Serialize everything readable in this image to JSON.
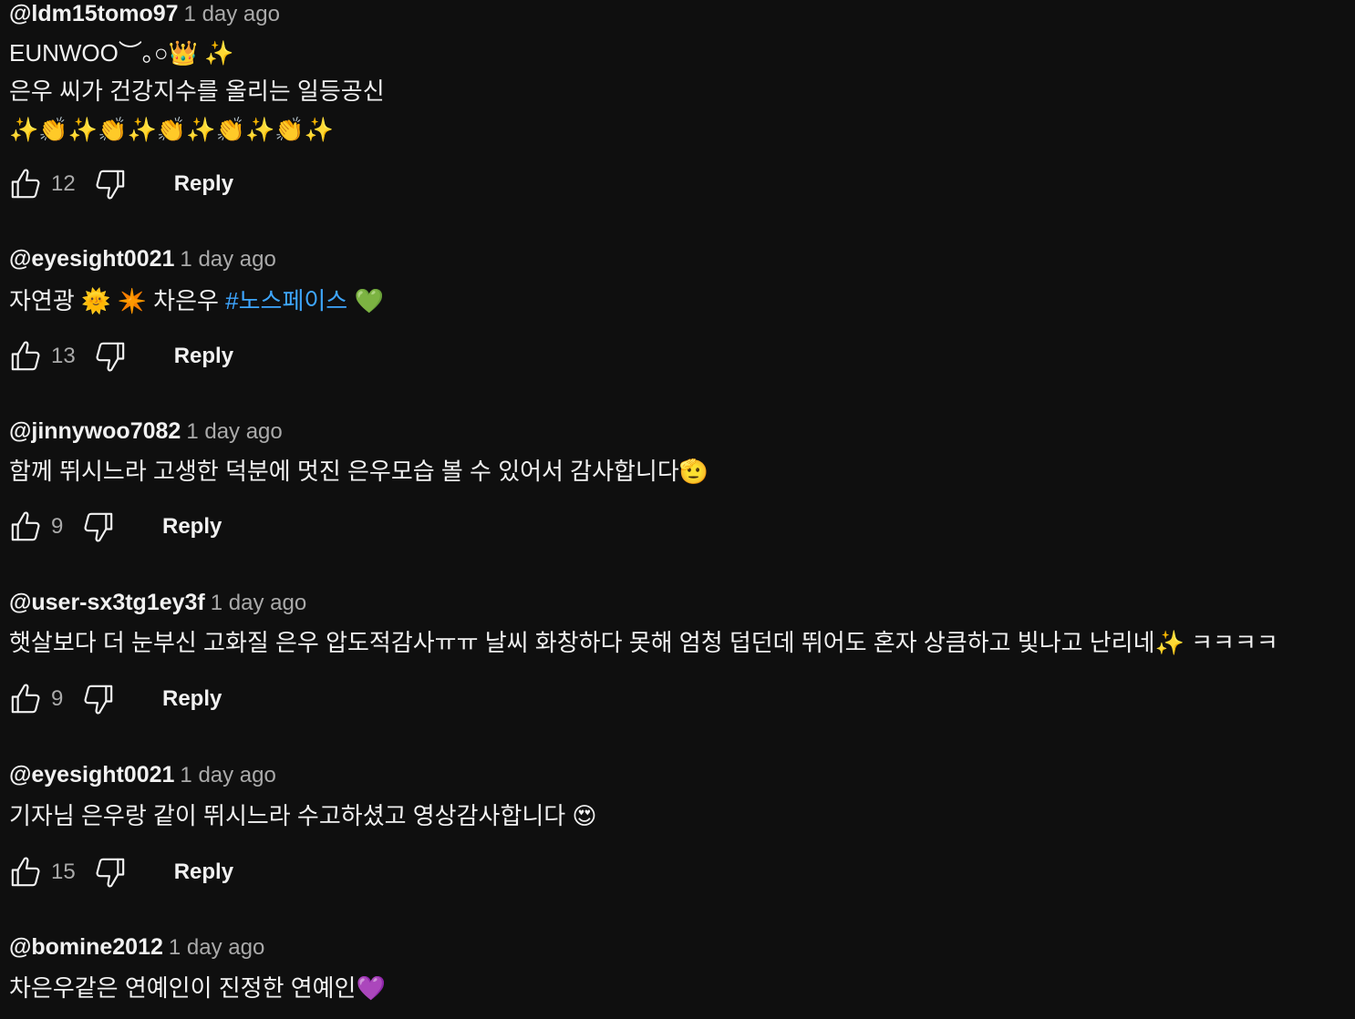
{
  "comments": [
    {
      "author": "@ldm15tomo97",
      "time": "1 day ago",
      "lines": [
        {
          "segments": [
            {
              "text": "EUNWOO︶｡○👑 ✨"
            }
          ]
        },
        {
          "segments": [
            {
              "text": "은우 씨가 건강지수를 올리는 일등공신"
            }
          ]
        },
        {
          "segments": [
            {
              "text": "✨👏✨👏✨👏✨👏✨👏✨"
            }
          ]
        }
      ],
      "likes": "12",
      "reply_label": "Reply"
    },
    {
      "author": "@eyesight0021",
      "time": "1 day ago",
      "lines": [
        {
          "segments": [
            {
              "text": "자연광 🌞 ✴️ 차은우 "
            },
            {
              "text": "#노스페이스",
              "hashtag": true
            },
            {
              "text": " 💚"
            }
          ]
        }
      ],
      "likes": "13",
      "reply_label": "Reply"
    },
    {
      "author": "@jinnywoo7082",
      "time": "1 day ago",
      "lines": [
        {
          "segments": [
            {
              "text": "함께 뛰시느라 고생한 덕분에 멋진 은우모습 볼 수 있어서 감사합니다🫡"
            }
          ]
        }
      ],
      "likes": "9",
      "reply_label": "Reply"
    },
    {
      "author": "@user-sx3tg1ey3f",
      "time": "1 day ago",
      "lines": [
        {
          "segments": [
            {
              "text": "햇살보다 더 눈부신 고화질 은우 압도적감사ㅠㅠ 날씨 화창하다 못해 엄청 덥던데 뛰어도 혼자 상큼하고 빛나고 난리네✨ ㅋㅋㅋㅋ"
            }
          ]
        }
      ],
      "likes": "9",
      "reply_label": "Reply"
    },
    {
      "author": "@eyesight0021",
      "time": "1 day ago",
      "lines": [
        {
          "segments": [
            {
              "text": "기자님 은우랑 같이 뛰시느라 수고하셨고 영상감사합니다 😍"
            }
          ]
        }
      ],
      "likes": "15",
      "reply_label": "Reply"
    },
    {
      "author": "@bomine2012",
      "time": "1 day ago",
      "lines": [
        {
          "segments": [
            {
              "text": "차은우같은 연예인이 진정한 연예인💜"
            }
          ]
        }
      ],
      "likes": "",
      "reply_label": ""
    }
  ],
  "icons": {
    "like": "thumbs-up-outline",
    "dislike": "thumbs-down-outline"
  },
  "colors": {
    "background": "#0f0f0f",
    "text": "#f1f1f1",
    "secondary_text": "#aaaaaa",
    "hashtag": "#3ea6ff"
  }
}
